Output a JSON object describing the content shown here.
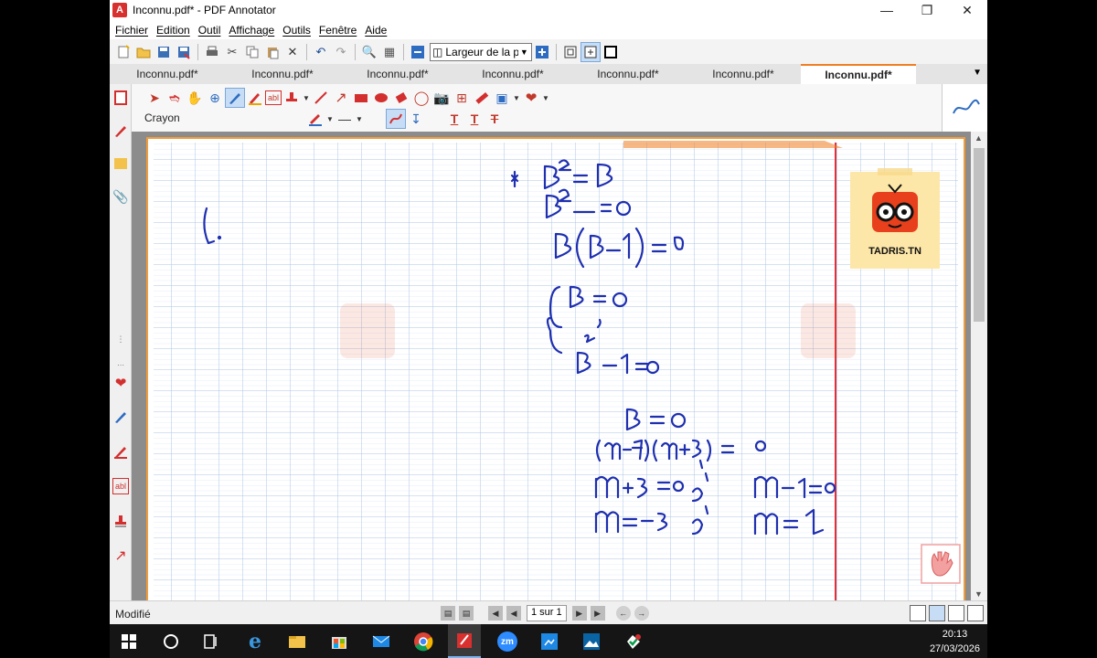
{
  "window": {
    "title": "Inconnu.pdf* - PDF Annotator"
  },
  "menu": [
    "Fichier",
    "Edition",
    "Outil",
    "Affichage",
    "Outils",
    "Fenêtre",
    "Aide"
  ],
  "toolbar": {
    "zoom_label": "Largeur de la pa"
  },
  "tabs": [
    "Inconnu.pdf*",
    "Inconnu.pdf*",
    "Inconnu.pdf*",
    "Inconnu.pdf*",
    "Inconnu.pdf*",
    "Inconnu.pdf*",
    "Inconnu.pdf*"
  ],
  "tool_panel": {
    "label": "Crayon"
  },
  "logo": {
    "text": "TADRIS.TN"
  },
  "status": {
    "text": "Modifié",
    "page_indicator": "1 sur 1"
  },
  "taskbar": {
    "time": "20:13",
    "date": "27/03/2026",
    "zoom_label": "zm"
  },
  "colors": {
    "accent": "#f07e22",
    "annotation_red": "#d32f2f",
    "ink_blue": "#1e2fb0",
    "margin_red": "#e0303a"
  }
}
